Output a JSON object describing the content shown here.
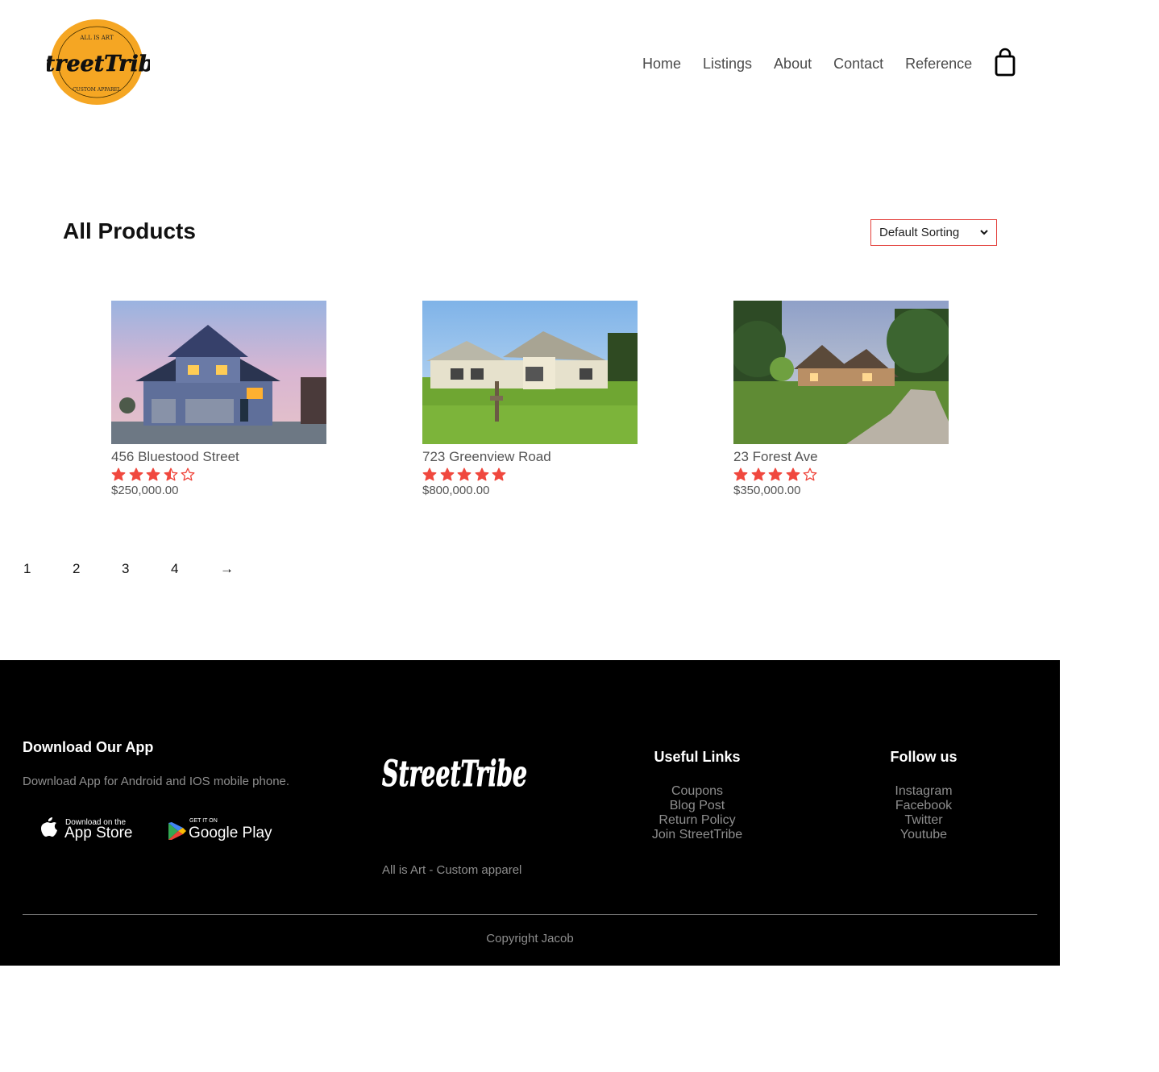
{
  "header": {
    "logo": {
      "text": "StreetTribe",
      "top_arc": "ALL IS ART",
      "bottom_arc": "CUSTOM APPAREL",
      "color": "#f5a623"
    },
    "nav": [
      "Home",
      "Listings",
      "About",
      "Contact",
      "Reference"
    ],
    "cart_icon": "shopping-bag-icon"
  },
  "main": {
    "title": "All Products",
    "sort": {
      "selected": "Default Sorting"
    },
    "products": [
      {
        "name": "456 Bluestood Street",
        "rating": 3.5,
        "price": "$250,000.00"
      },
      {
        "name": "723 Greenview Road",
        "rating": 5,
        "price": "$800,000.00"
      },
      {
        "name": "23 Forest Ave",
        "rating": 4,
        "price": "$350,000.00"
      }
    ],
    "pagination": [
      "1",
      "2",
      "3",
      "4",
      "→"
    ]
  },
  "footer": {
    "app": {
      "heading": "Download Our App",
      "text": "Download App for Android and IOS mobile phone.",
      "appstore_small": "Download on the",
      "appstore_big": "App Store",
      "googleplay_small": "GET IT ON",
      "googleplay_big": "Google Play"
    },
    "brand": {
      "logo_text": "StreetTribe",
      "tagline": "All is Art - Custom apparel"
    },
    "useful_links": {
      "heading": "Useful Links",
      "items": [
        "Coupons",
        "Blog Post",
        "Return Policy",
        "Join StreetTribe"
      ]
    },
    "follow": {
      "heading": "Follow us",
      "items": [
        "Instagram",
        "Facebook",
        "Twitter",
        "Youtube"
      ]
    },
    "copyright": "Copyright Jacob"
  },
  "colors": {
    "accent": "#e3403b",
    "star": "#f0483e",
    "logo_yellow": "#f5a623",
    "footer_bg": "#000000"
  }
}
